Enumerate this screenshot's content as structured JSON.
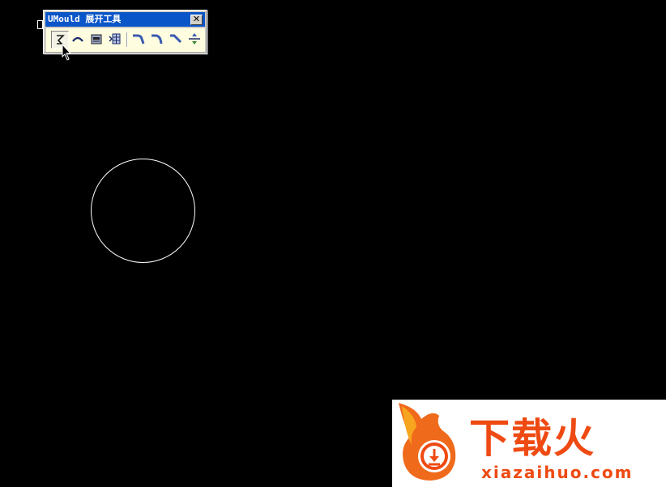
{
  "toolbar": {
    "title": "UMould 展开工具",
    "close_label": "✕",
    "tools": [
      {
        "icon": "unfold-polyline-icon",
        "pressed": true
      },
      {
        "icon": "arc-icon",
        "pressed": false
      },
      {
        "icon": "box-template-icon",
        "pressed": false
      },
      {
        "icon": "sheet-grid-icon",
        "pressed": false
      },
      {
        "icon": "bend-down-right-icon",
        "pressed": false
      },
      {
        "icon": "bend-curve-icon",
        "pressed": false
      },
      {
        "icon": "bend-diagonal-icon",
        "pressed": false
      },
      {
        "icon": "split-arrows-icon",
        "pressed": false
      }
    ]
  },
  "watermark": {
    "brand": "下载火",
    "url": "xiazaihuo.com"
  },
  "colors": {
    "canvas_bg": "#000000",
    "titlebar_blue": "#0a55c8",
    "toolbar_tint": "#fffde0",
    "icon_blue": "#3a5bb0",
    "watermark_orange": "#ee4a12"
  }
}
